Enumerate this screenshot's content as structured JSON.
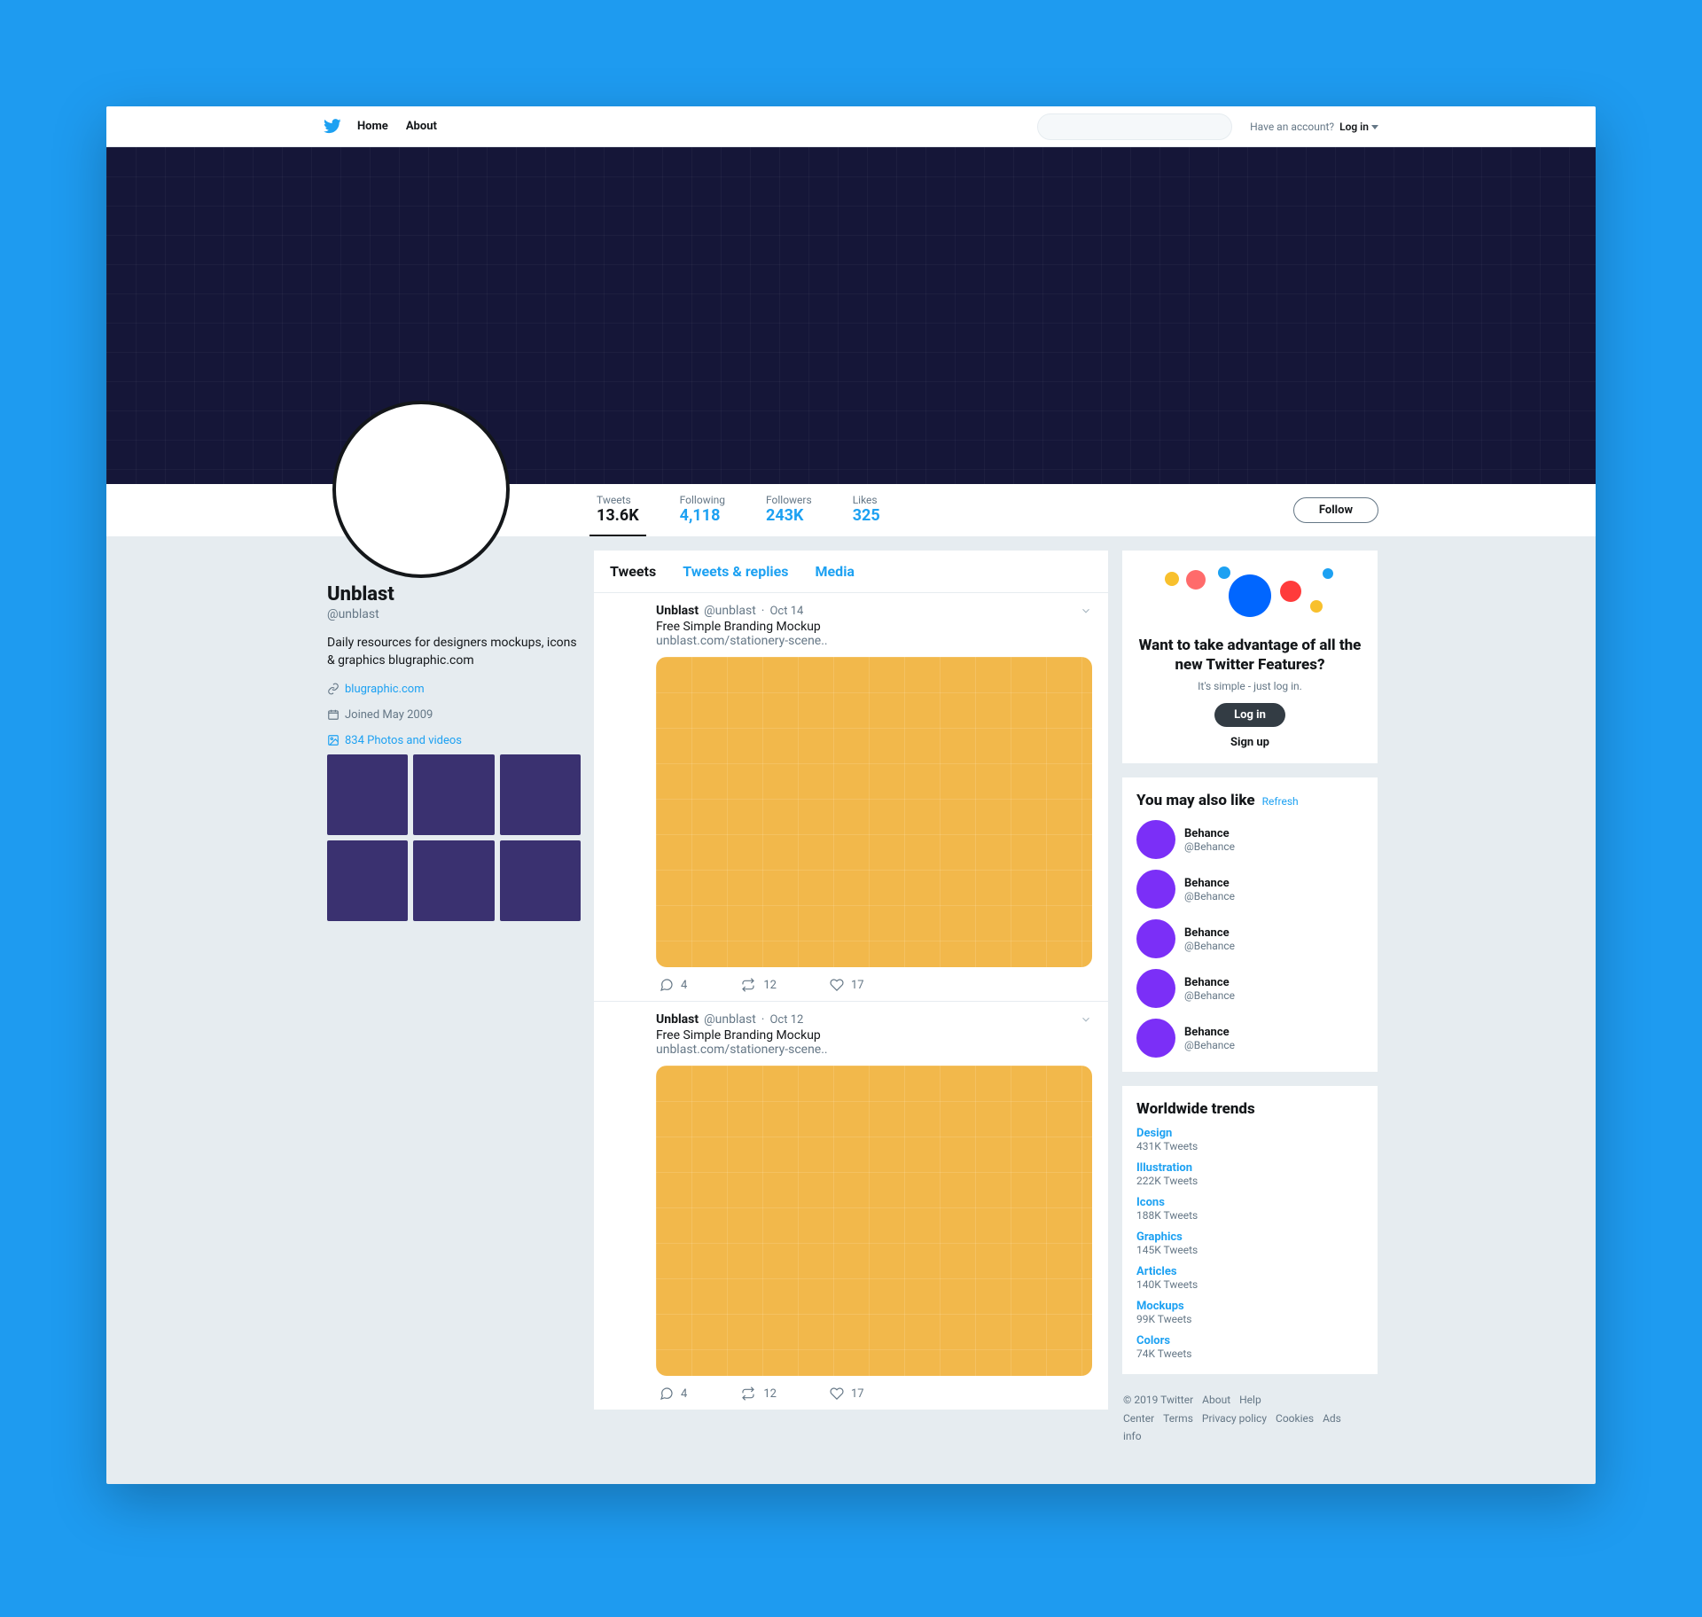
{
  "nav": {
    "home": "Home",
    "about": "About",
    "account_prompt": "Have an account?",
    "login": "Log in"
  },
  "stats": {
    "tweets_label": "Tweets",
    "tweets_value": "13.6K",
    "following_label": "Following",
    "following_value": "4,118",
    "followers_label": "Followers",
    "followers_value": "243K",
    "likes_label": "Likes",
    "likes_value": "325",
    "follow_btn": "Follow"
  },
  "profile": {
    "name": "Unblast",
    "handle": "@unblast",
    "bio": "Daily resources for designers mockups, icons & graphics blugraphic.com",
    "website": "blugraphic.com",
    "joined": "Joined May 2009",
    "media": "834 Photos and videos"
  },
  "midtabs": {
    "tweets": "Tweets",
    "replies": "Tweets & replies",
    "media": "Media"
  },
  "tweets": [
    {
      "author": "Unblast",
      "handle": "@unblast",
      "date": "Oct 14",
      "text": "Free Simple Branding Mockup",
      "link": "unblast.com/stationery-scene..",
      "replies": "4",
      "retweets": "12",
      "likes": "17"
    },
    {
      "author": "Unblast",
      "handle": "@unblast",
      "date": "Oct 12",
      "text": "Free Simple Branding Mockup",
      "link": "unblast.com/stationery-scene..",
      "replies": "4",
      "retweets": "12",
      "likes": "17"
    }
  ],
  "signup": {
    "title": "Want to take advantage of all the new Twitter Features?",
    "sub": "It's simple - just log in.",
    "login_btn": "Log in",
    "signup_btn": "Sign up"
  },
  "suggest": {
    "header": "You may also like",
    "refresh": "Refresh",
    "items": [
      {
        "name": "Behance",
        "handle": "@Behance"
      },
      {
        "name": "Behance",
        "handle": "@Behance"
      },
      {
        "name": "Behance",
        "handle": "@Behance"
      },
      {
        "name": "Behance",
        "handle": "@Behance"
      },
      {
        "name": "Behance",
        "handle": "@Behance"
      }
    ]
  },
  "trends": {
    "header": "Worldwide trends",
    "items": [
      {
        "name": "Design",
        "count": "431K Tweets"
      },
      {
        "name": "Illustration",
        "count": "222K Tweets"
      },
      {
        "name": "Icons",
        "count": "188K Tweets"
      },
      {
        "name": "Graphics",
        "count": "145K Tweets"
      },
      {
        "name": "Articles",
        "count": "140K Tweets"
      },
      {
        "name": "Mockups",
        "count": "99K Tweets"
      },
      {
        "name": "Colors",
        "count": "74K Tweets"
      }
    ]
  },
  "footer": {
    "copyright": "© 2019 Twitter",
    "links": [
      "About",
      "Help Center",
      "Terms",
      "Privacy policy",
      "Cookies",
      "Ads info"
    ]
  }
}
